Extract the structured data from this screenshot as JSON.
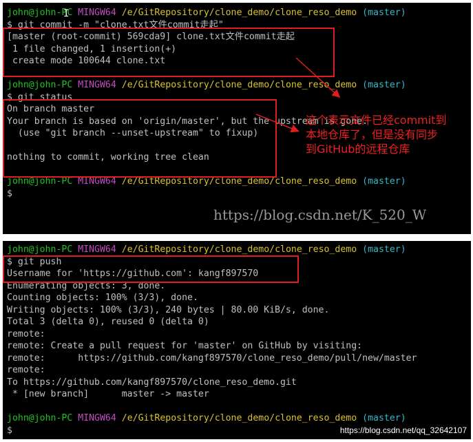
{
  "terminal1": {
    "prompt1": {
      "user": "john@john-PC",
      "host": "MINGW64",
      "path": "/e/GitRepository/clone_demo/clone_reso_demo",
      "branch": "(master)"
    },
    "lines_block1": [
      "$ git commit -m \"clone.txt文件commit走起\"",
      "[master (root-commit) 569cda9] clone.txt文件commit走起",
      " 1 file changed, 1 insertion(+)",
      " create mode 100644 clone.txt"
    ],
    "prompt2": {
      "user": "john@john-PC",
      "host": "MINGW64",
      "path": "/e/GitRepository/clone_demo/clone_reso_demo",
      "branch": "(master)"
    },
    "lines_block2": [
      "$ git status",
      "On branch master",
      "Your branch is based on 'origin/master', but the upstream is gone.",
      "  (use \"git branch --unset-upstream\" to fixup)",
      "",
      "nothing to commit, working tree clean"
    ],
    "prompt3": {
      "user": "john@john-PC",
      "host": "MINGW64",
      "path": "/e/GitRepository/clone_demo/clone_reso_demo",
      "branch": "(master)"
    },
    "final_prompt": "$",
    "annotation": "这个表示文件已经commit到\n本地仓库了，但是没有同步\n到GitHub的远程仓库",
    "watermark": "https://blog.csdn.net/K_520_W"
  },
  "terminal2": {
    "prompt1": {
      "user": "john@john-PC",
      "host": "MINGW64",
      "path": "/e/GitRepository/clone_demo/clone_reso_demo",
      "branch": "(master)"
    },
    "lines": [
      "$ git push",
      "Username for 'https://github.com': kangf897570",
      "Enumerating objects: 3, done.",
      "Counting objects: 100% (3/3), done.",
      "Writing objects: 100% (3/3), 240 bytes | 80.00 KiB/s, done.",
      "Total 3 (delta 0), reused 0 (delta 0)",
      "remote:",
      "remote: Create a pull request for 'master' on GitHub by visiting:",
      "remote:      https://github.com/kangf897570/clone_reso_demo/pull/new/master",
      "remote:",
      "To https://github.com/kangf897570/clone_reso_demo.git",
      " * [new branch]      master -> master"
    ],
    "prompt2": {
      "user": "john@john-PC",
      "host": "MINGW64",
      "path": "/e/GitRepository/clone_demo/clone_reso_demo",
      "branch": "(master)"
    },
    "final_prompt": "$",
    "source_watermark": "https://blog.csdn.net/qq_32642107"
  },
  "colors": {
    "terminal_bg": "#000000",
    "user": "#1fc41f",
    "host": "#c34cc3",
    "path": "#d8c32e",
    "branch": "#34b8c8",
    "annotation": "#f02020"
  }
}
